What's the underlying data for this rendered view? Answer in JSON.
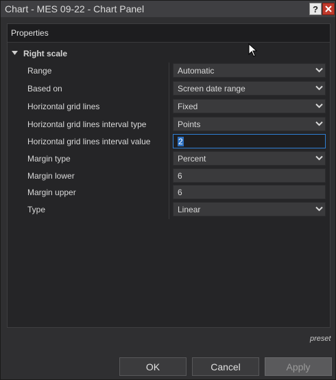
{
  "window": {
    "title": "Chart - MES 09-22 - Chart Panel",
    "help_label": "?",
    "close_icon": "close-icon"
  },
  "properties": {
    "header": "Properties",
    "category": "Right scale",
    "rows": [
      {
        "label": "Range",
        "value": "Automatic",
        "control": "dropdown"
      },
      {
        "label": "Based on",
        "value": "Screen date range",
        "control": "dropdown"
      },
      {
        "label": "Horizontal grid lines",
        "value": "Fixed",
        "control": "dropdown"
      },
      {
        "label": "Horizontal grid lines interval type",
        "value": "Points",
        "control": "dropdown"
      },
      {
        "label": "Horizontal grid lines interval value",
        "value": "2",
        "control": "text-input-focused"
      },
      {
        "label": "Margin type",
        "value": "Percent",
        "control": "dropdown"
      },
      {
        "label": "Margin lower",
        "value": "6",
        "control": "text-input"
      },
      {
        "label": "Margin upper",
        "value": "6",
        "control": "text-input"
      },
      {
        "label": "Type",
        "value": "Linear",
        "control": "dropdown"
      }
    ]
  },
  "footer": {
    "preset": "preset",
    "ok": "OK",
    "cancel": "Cancel",
    "apply": "Apply",
    "apply_enabled": false
  },
  "colors": {
    "background": "#2f2f31",
    "panel": "#252527",
    "accent": "#2f7fd4",
    "close": "#c0392b"
  }
}
